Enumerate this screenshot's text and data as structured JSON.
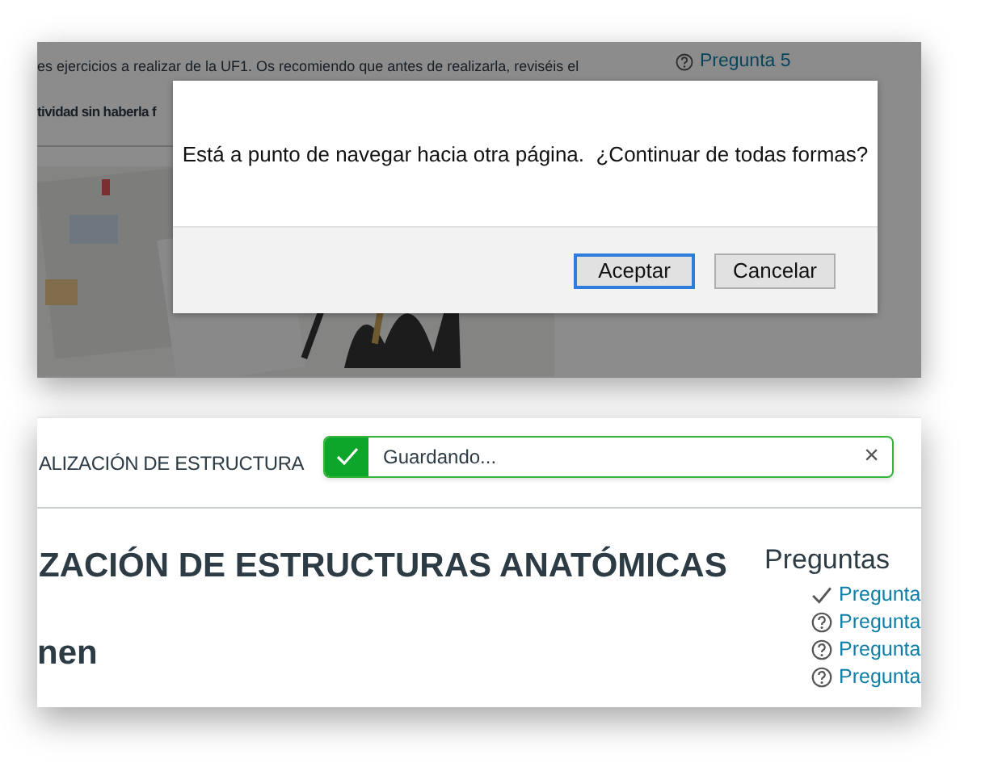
{
  "background_page": {
    "paragraph": "es ejercicios a realizar de la UF1. Os recomiendo que antes de realizarla, reviséis el",
    "bold_line": "tividad sin haberla f",
    "questions": [
      {
        "label": "Pregunta 5",
        "answered": false
      }
    ]
  },
  "dialog": {
    "message": "Está a punto de navegar hacia otra página.  ¿Continuar de todas formas?",
    "buttons": [
      {
        "label": "Aceptar",
        "focused": true
      },
      {
        "label": "Cancelar",
        "focused": false
      }
    ]
  },
  "quiz_page": {
    "header_title": "ALIZACIÓN DE ESTRUCTURA",
    "toast": {
      "message": "Guardando...",
      "close": "×"
    },
    "title": "ZACIÓN DE ESTRUCTURAS ANATÓMICAS",
    "subtitle": "nen",
    "sidebar_title": "Preguntas",
    "questions": [
      {
        "label": "Pregunta",
        "answered": true
      },
      {
        "label": "Pregunta",
        "answered": false
      },
      {
        "label": "Pregunta",
        "answered": false
      },
      {
        "label": "Pregunta",
        "answered": false
      }
    ]
  }
}
